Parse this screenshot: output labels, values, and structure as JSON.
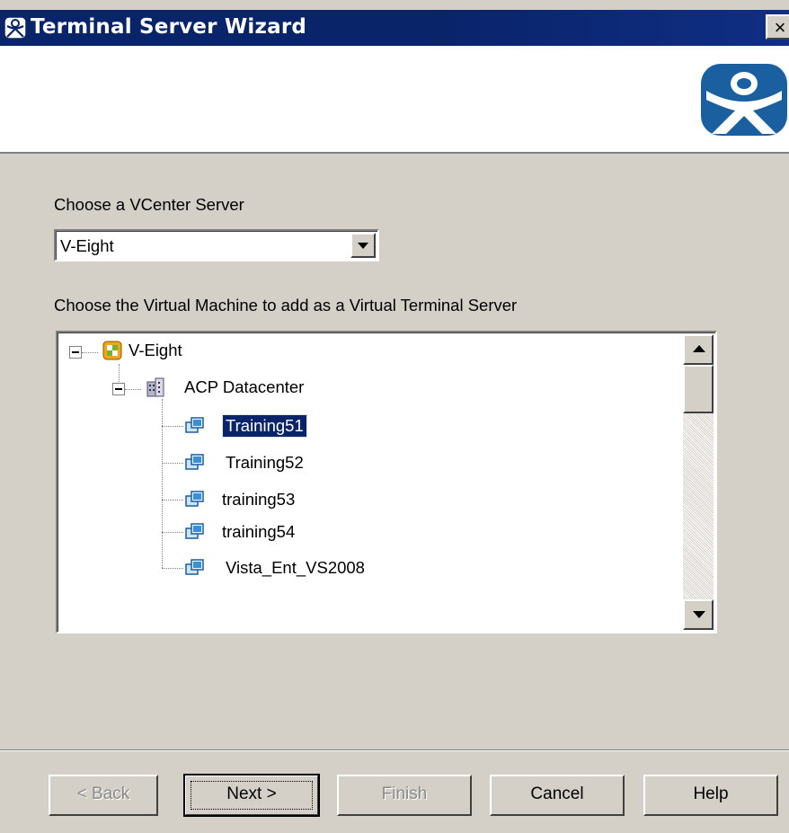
{
  "window": {
    "title": "Terminal Server Wizard",
    "close_glyph": "×",
    "title_icon": "wizard-logo-icon",
    "header_logo": "thinmanager-logo-icon"
  },
  "vcenter": {
    "label": "Choose a VCenter Server",
    "selected": "V-Eight"
  },
  "vm": {
    "label": "Choose the Virtual Machine to add as a Virtual Terminal Server",
    "tree": {
      "root": "V-Eight",
      "datacenter": "ACP Datacenter",
      "machines": [
        "Training51",
        "Training52",
        "training53",
        "training54",
        "Vista_Ent_VS2008"
      ],
      "selected": "Training51"
    }
  },
  "buttons": {
    "back": "< Back",
    "next": "Next >",
    "finish": "Finish",
    "cancel": "Cancel",
    "help": "Help"
  },
  "colors": {
    "titlebar": "#0a246a",
    "dialog": "#d4d0c8",
    "selection": "#0a246a",
    "logo": "#1a5fa0"
  }
}
